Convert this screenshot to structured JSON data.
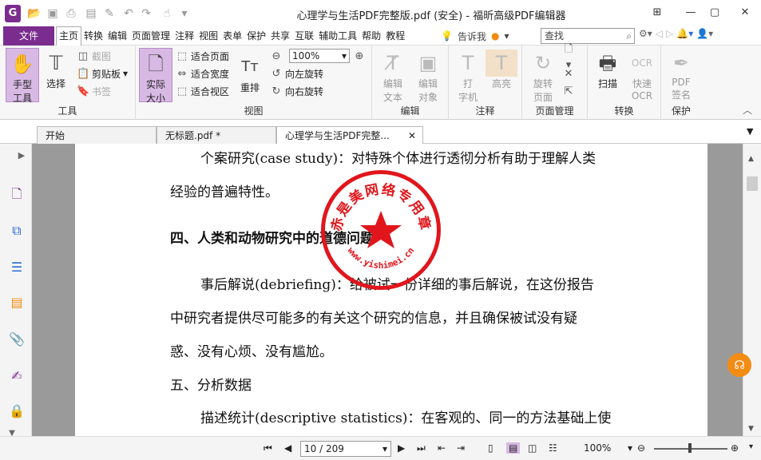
{
  "window": {
    "title": "心理学与生活PDF完整版.pdf (安全) - 福昕高级PDF编辑器"
  },
  "menu": {
    "file": "文件",
    "items": [
      "主页",
      "转换",
      "编辑",
      "页面管理",
      "注释",
      "视图",
      "表单",
      "保护",
      "共享",
      "互联",
      "辅助工具",
      "帮助",
      "教程"
    ],
    "tell_me": "告诉我",
    "search_placeholder": "查找"
  },
  "ribbon": {
    "tools": {
      "hand": "手型\n工具",
      "select": "选择",
      "screenshot": "截图",
      "clipboard": "剪贴板",
      "bookmark": "书签",
      "label": "工具"
    },
    "view": {
      "actual_size": "实际\n大小",
      "fit_page": "适合页面",
      "fit_width": "适合宽度",
      "fit_visible": "适合视区",
      "reflow": "重排",
      "zoom": "100%",
      "rotate_left": "向左旋转",
      "rotate_right": "向右旋转",
      "label": "视图"
    },
    "edit": {
      "edit_text": "编辑\n文本",
      "edit_object": "编辑\n对象",
      "label": "编辑"
    },
    "comment": {
      "typewriter": "打\n字机",
      "highlight": "高亮",
      "label": "注释"
    },
    "page_mgmt": {
      "rotate_page": "旋转\n页面",
      "label": "页面管理"
    },
    "convert": {
      "scan": "扫描",
      "quick_ocr": "快速\nOCR",
      "label": "转换"
    },
    "protect": {
      "pdf_sign": "PDF\n签名",
      "label": "保护"
    }
  },
  "tabs": [
    {
      "label": "开始"
    },
    {
      "label": "无标题.pdf *"
    },
    {
      "label": "心理学与生活PDF完整..."
    }
  ],
  "document": {
    "lines": [
      "个案研究(case study)：对特殊个体进行透彻分析有助于理解人类",
      "经验的普遍特性。",
      "四、人类和动物研究中的道德问题",
      "事后解说(debriefing)：给被试一份详细的事后解说，在这份报告",
      "中研究者提供尽可能多的有关这个研究的信息，并且确保被试没有疑",
      "惑、没有心烦、没有尴尬。",
      "五、分析数据",
      "描述统计(descriptive statistics)：在客观的、同一的方法基础上使"
    ],
    "seal_text": "赤是美网络专用章",
    "seal_url": "www.yishimei.cn"
  },
  "status": {
    "page": "10 / 209",
    "zoom": "100%"
  }
}
